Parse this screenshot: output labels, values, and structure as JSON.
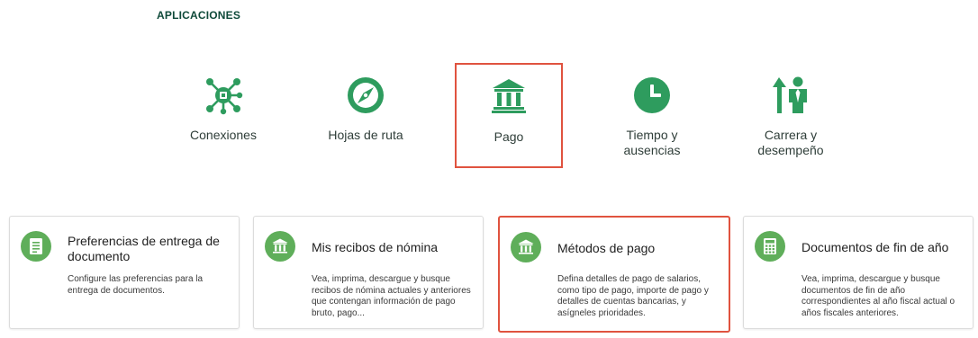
{
  "section_title": "APLICACIONES",
  "apps": [
    {
      "label": "Conexiones",
      "icon": "connections-hub-icon"
    },
    {
      "label": "Hojas de ruta",
      "icon": "compass-icon"
    },
    {
      "label": "Pago",
      "icon": "bank-building-icon"
    },
    {
      "label_line1": "Tiempo y",
      "label_line2": "ausencias",
      "icon": "clock-icon"
    },
    {
      "label_line1": "Carrera y",
      "label_line2": "desempeño",
      "icon": "person-growth-icon"
    }
  ],
  "cards": [
    {
      "title": "Preferencias de entrega de documento",
      "desc": "Configure las preferencias para la entrega de documentos.",
      "icon": "document-icon"
    },
    {
      "title": "Mis recibos de nómina",
      "desc": "Vea, imprima, descargue y busque recibos de nómina actuales y anteriores que contengan información de pago bruto, pago...",
      "icon": "bank-building-icon"
    },
    {
      "title": "Métodos de pago",
      "desc": "Defina detalles de pago de salarios, como tipo de pago, importe de pago y detalles de cuentas bancarias, y asígneles prioridades.",
      "icon": "bank-building-icon"
    },
    {
      "title": "Documentos de fin de año",
      "desc": "Vea, imprima, descargue y busque documentos de fin de año correspondientes al año fiscal actual o años fiscales anteriores.",
      "icon": "calculator-icon"
    }
  ],
  "colors": {
    "app_icon": "#2e9c5e",
    "card_badge": "#5fae5a",
    "highlight": "#e0533f",
    "section_title": "#0f4a3a"
  }
}
